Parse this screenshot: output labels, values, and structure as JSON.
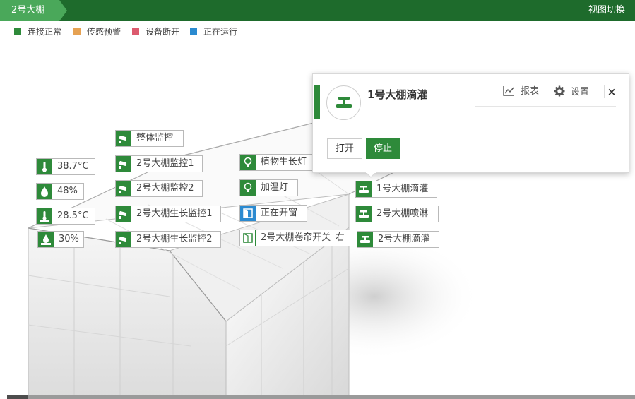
{
  "header": {
    "breadcrumb": "2号大棚",
    "view_switch": "视图切换",
    "bg_color": "#1e6b2c",
    "crumb_color": "#4aa85a"
  },
  "legend": [
    {
      "label": "连接正常",
      "color": "#2e8a3a"
    },
    {
      "label": "传感预警",
      "color": "#e6a253"
    },
    {
      "label": "设备断开",
      "color": "#dc5a6e"
    },
    {
      "label": "正在运行",
      "color": "#2b8ad0"
    }
  ],
  "sensors": [
    {
      "value": "38.7°C",
      "icon": "thermometer-icon"
    },
    {
      "value": "48%",
      "icon": "humidity-drop-icon"
    },
    {
      "value": "28.5°C",
      "icon": "soil-temperature-icon"
    },
    {
      "value": "30%",
      "icon": "soil-moisture-icon"
    }
  ],
  "cameras": [
    {
      "label": "整体监控",
      "icon": "camera-icon"
    },
    {
      "label": "2号大棚监控1",
      "icon": "camera-icon"
    },
    {
      "label": "2号大棚监控2",
      "icon": "camera-icon"
    },
    {
      "label": "2号大棚生长监控1",
      "icon": "camera-icon"
    },
    {
      "label": "2号大棚生长监控2",
      "icon": "camera-icon"
    }
  ],
  "devices": [
    {
      "label": "植物生长灯",
      "icon": "bulb-icon"
    },
    {
      "label": "加温灯",
      "icon": "bulb-icon"
    },
    {
      "label": "正在开窗",
      "icon": "window-icon",
      "status": "running"
    },
    {
      "label": "2号大棚卷帘开关_右",
      "icon": "window-icon"
    }
  ],
  "irrigation": [
    {
      "label": "1号大棚滴灌",
      "icon": "valve-icon"
    },
    {
      "label": "2号大棚喷淋",
      "icon": "valve-icon"
    },
    {
      "label": "2号大棚滴灌",
      "icon": "valve-icon"
    }
  ],
  "popup": {
    "title": "1号大棚滴灌",
    "report_label": "报表",
    "settings_label": "设置",
    "close_label": "×",
    "open_label": "打开",
    "stop_label": "停止"
  }
}
